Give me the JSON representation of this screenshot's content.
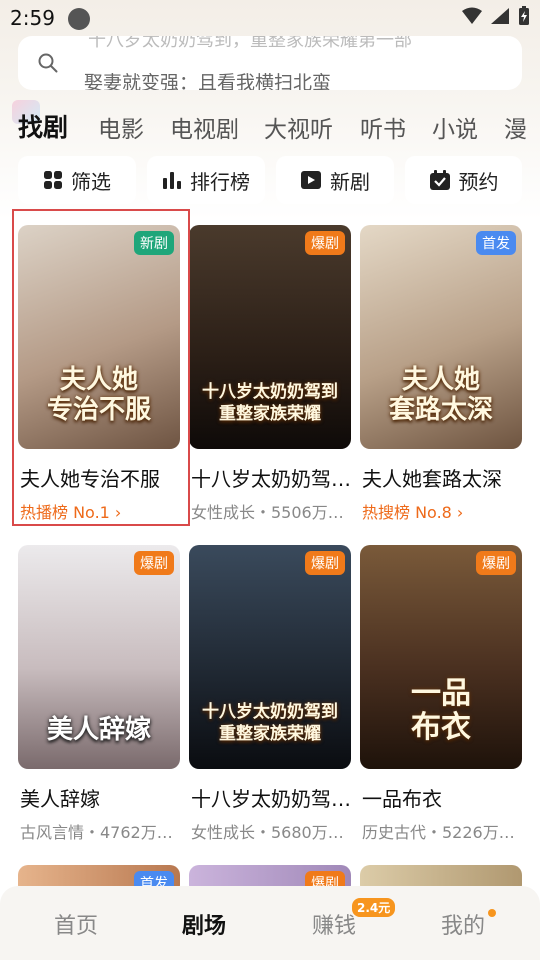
{
  "status_bar": {
    "time": "2:59"
  },
  "search": {
    "ghost_text": "十八岁太奶奶驾到，重整家族荣耀第一部",
    "placeholder": "娶妻就变强：且看我横扫北蛮"
  },
  "tabs": [
    {
      "label": "找剧",
      "active": true
    },
    {
      "label": "电影"
    },
    {
      "label": "电视剧"
    },
    {
      "label": "大视听"
    },
    {
      "label": "听书"
    },
    {
      "label": "小说"
    },
    {
      "label": "漫"
    }
  ],
  "filters": [
    {
      "label": "筛选",
      "icon": "grid-icon"
    },
    {
      "label": "排行榜",
      "icon": "bar-chart-icon"
    },
    {
      "label": "新剧",
      "icon": "play-icon"
    },
    {
      "label": "预约",
      "icon": "calendar-check-icon"
    }
  ],
  "cards": [
    {
      "name": "夫人她专治不服",
      "meta": "热播榜 No.1 ›",
      "meta_hot": true,
      "badge": "新剧",
      "badge_color": "#1fa67a",
      "poster_title": "夫人她\n专治不服",
      "colors": [
        "#d9cfc4",
        "#8b6a55"
      ]
    },
    {
      "name": "十八岁太奶奶驾…",
      "meta": "女性成长・5506万…",
      "meta_hot": false,
      "badge": "爆剧",
      "badge_color": "#f07a1a",
      "poster_title": "十八岁太奶奶驾到\n重整家族荣耀",
      "colors": [
        "#3a2c22",
        "#1c1410"
      ]
    },
    {
      "name": "夫人她套路太深",
      "meta": "热搜榜 No.8 ›",
      "meta_hot": true,
      "badge": "首发",
      "badge_color": "#4a8af0",
      "poster_title": "夫人她\n套路太深",
      "colors": [
        "#d8cbb8",
        "#7a6048"
      ]
    },
    {
      "name": "美人辞嫁",
      "meta": "古风言情・4762万…",
      "meta_hot": false,
      "badge": "爆剧",
      "badge_color": "#f07a1a",
      "poster_title": "美人辞嫁",
      "colors": [
        "#e6e4e6",
        "#9a8c8e"
      ]
    },
    {
      "name": "十八岁太奶奶驾…",
      "meta": "女性成长・5680万…",
      "meta_hot": false,
      "badge": "爆剧",
      "badge_color": "#f07a1a",
      "poster_title": "十八岁太奶奶驾到\n重整家族荣耀",
      "colors": [
        "#2e3a4a",
        "#12161c"
      ]
    },
    {
      "name": "一品布衣",
      "meta": "历史古代・5226万…",
      "meta_hot": false,
      "badge": "爆剧",
      "badge_color": "#f07a1a",
      "poster_title": "一品\n布衣",
      "colors": [
        "#6a4a2e",
        "#2a1a10"
      ]
    },
    {
      "name": "",
      "meta": "",
      "badge": "首发",
      "badge_color": "#4a8af0",
      "poster_title": "",
      "colors": [
        "#e2b08a",
        "#b87850"
      ]
    },
    {
      "name": "",
      "meta": "",
      "badge": "爆剧",
      "badge_color": "#f07a1a",
      "poster_title": "",
      "colors": [
        "#c8b0d8",
        "#a088b8"
      ]
    },
    {
      "name": "",
      "meta": "",
      "badge": "",
      "badge_color": "#f07a1a",
      "poster_title": "",
      "colors": [
        "#d8c8a8",
        "#b09870"
      ]
    }
  ],
  "bottom_nav": [
    {
      "label": "首页"
    },
    {
      "label": "剧场",
      "active": true
    },
    {
      "label": "赚钱",
      "badge": "2.4元"
    },
    {
      "label": "我的",
      "dot": true
    }
  ]
}
